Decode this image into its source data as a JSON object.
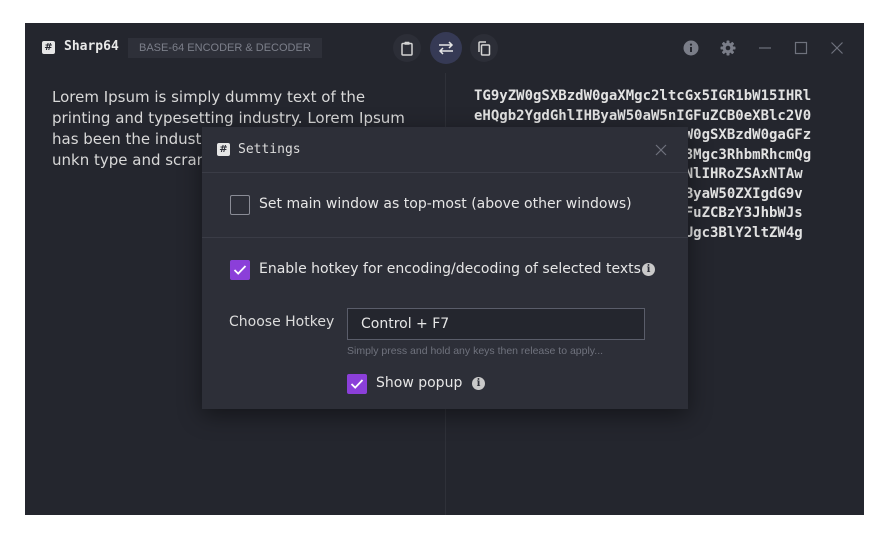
{
  "app": {
    "title": "Sharp64",
    "subtitle": "BASE-64 ENCODER & DECODER",
    "logo_glyph": "#"
  },
  "toolbar": {
    "icons": [
      "clipboard-icon",
      "swap-icon",
      "copy-icon"
    ],
    "active": "swap-icon"
  },
  "window_controls": [
    "info-icon",
    "gear-icon",
    "minimize-icon",
    "maximize-icon",
    "close-icon"
  ],
  "editor": {
    "input_text": "Lorem Ipsum is simply dummy text of the printing and typesetting industry. Lorem Ipsum has been the industry's standa 1500s, when an unkn type and scrambled book.",
    "output_text": "TG9yZW0gSXBzdW0gaXMgc2ltcGx5IGR1bW15IHRl\neHQgb2YgdGhlIHByaW50aW5nIGFuZCB0eXBlc2V0\n                       yZW0gSXBzdW0gaGFz\n                       5J3Mgc3RhbmRhcmQg\n                       bmNlIHRoZSAxNTAw\n                       IHByaW50ZXIgdG9v\n                       IGFuZCBzY3JhbWJs\n                       cGUgc3BlY2ltZW4g"
  },
  "settings_dialog": {
    "logo_glyph": "#",
    "title": "Settings",
    "topmost": {
      "label": "Set main window as top-most (above other windows)",
      "checked": false
    },
    "hotkey_enable": {
      "label": "Enable hotkey for encoding/decoding of selected texts",
      "checked": true
    },
    "hotkey": {
      "label": "Choose Hotkey",
      "value": "Control + F7",
      "hint": "Simply press and hold any keys then release to apply..."
    },
    "popup": {
      "label": "Show popup",
      "checked": true
    },
    "info_glyph": "i"
  },
  "colors": {
    "window_bg": "#24262e",
    "dialog_bg": "#2d2f38",
    "accent": "#8b3fd9",
    "active_button": "#363a55"
  }
}
